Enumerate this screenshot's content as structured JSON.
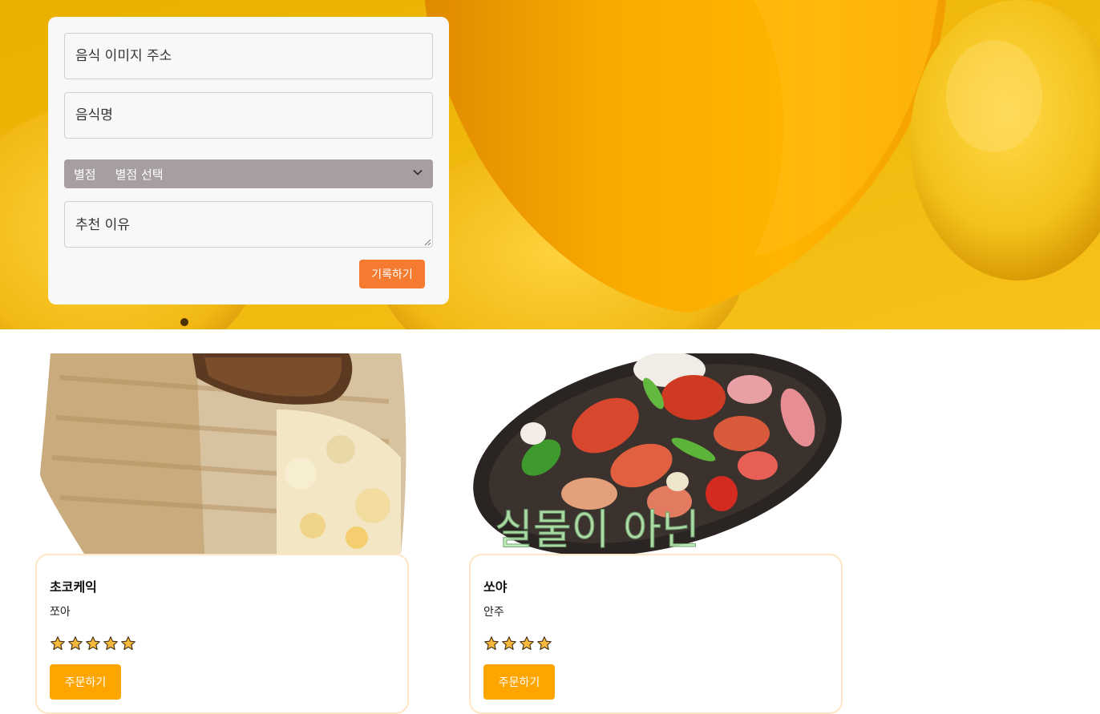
{
  "form": {
    "image_url_placeholder": "음식 이미지 주소",
    "name_placeholder": "음식명",
    "rating_label": "별점",
    "rating_selected": "별점 선택",
    "reason_placeholder": "추천 이유",
    "submit_label": "기록하기"
  },
  "foods": [
    {
      "name": "초코케익",
      "author": "쪼아",
      "rating": 5,
      "order_label": "주문하기"
    },
    {
      "name": "쏘야",
      "author": "안주",
      "rating": 4,
      "order_label": "주문하기",
      "image_caption": "실물이 아닌"
    }
  ],
  "colors": {
    "submit": "#f47b2f",
    "order": "#ffa500",
    "rating_select_bg": "#a69e9f",
    "star": "#f6b93b"
  }
}
